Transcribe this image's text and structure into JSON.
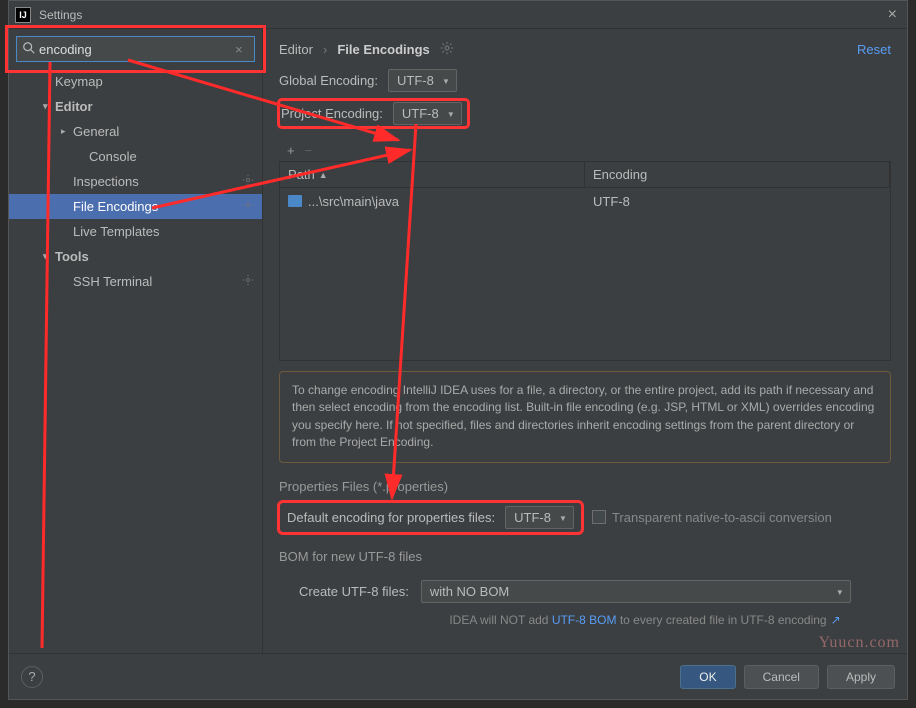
{
  "titlebar": {
    "title": "Settings"
  },
  "search": {
    "value": "encoding"
  },
  "sidebar": {
    "items": [
      {
        "label": "Keymap",
        "type": "leaf",
        "pad": 1
      },
      {
        "label": "Editor",
        "type": "exp",
        "pad": 1,
        "bold": true
      },
      {
        "label": "General",
        "type": "col",
        "pad": 2
      },
      {
        "label": "Console",
        "type": "leaf",
        "pad": 3
      },
      {
        "label": "Inspections",
        "type": "leaf",
        "pad": 2,
        "gear": true
      },
      {
        "label": "File Encodings",
        "type": "leaf",
        "pad": 2,
        "gear": true,
        "sel": true
      },
      {
        "label": "Live Templates",
        "type": "leaf",
        "pad": 2
      },
      {
        "label": "Tools",
        "type": "exp",
        "pad": 1,
        "bold": true
      },
      {
        "label": "SSH Terminal",
        "type": "leaf",
        "pad": 2,
        "gear": true
      }
    ]
  },
  "breadcrumb": {
    "c1": "Editor",
    "c2": "File Encodings",
    "reset": "Reset"
  },
  "global_enc": {
    "label": "Global Encoding:",
    "value": "UTF-8"
  },
  "project_enc": {
    "label": "Project Encoding:",
    "value": "UTF-8"
  },
  "toolbar": {
    "add": "+",
    "remove": "−"
  },
  "table": {
    "cols": [
      "Path",
      "Encoding"
    ],
    "rows": [
      {
        "path": "...\\src\\main\\java",
        "enc": "UTF-8"
      }
    ]
  },
  "info": "To change encoding IntelliJ IDEA uses for a file, a directory, or the entire project, add its path if necessary and then select encoding from the encoding list. Built-in file encoding (e.g. JSP, HTML or XML) overrides encoding you specify here. If not specified, files and directories inherit encoding settings from the parent directory or from the Project Encoding.",
  "props_section": "Properties Files (*.properties)",
  "props": {
    "label": "Default encoding for properties files:",
    "value": "UTF-8",
    "transparent": "Transparent native-to-ascii conversion"
  },
  "bom_section": "BOM for new UTF-8 files",
  "bom": {
    "label": "Create UTF-8 files:",
    "value": "with NO BOM"
  },
  "bom_note": {
    "p1": "IDEA will NOT add ",
    "link": "UTF-8 BOM",
    "p2": " to every created file in UTF-8 encoding"
  },
  "footer": {
    "ok": "OK",
    "cancel": "Cancel",
    "apply": "Apply"
  },
  "watermark": "Yuucn.com"
}
